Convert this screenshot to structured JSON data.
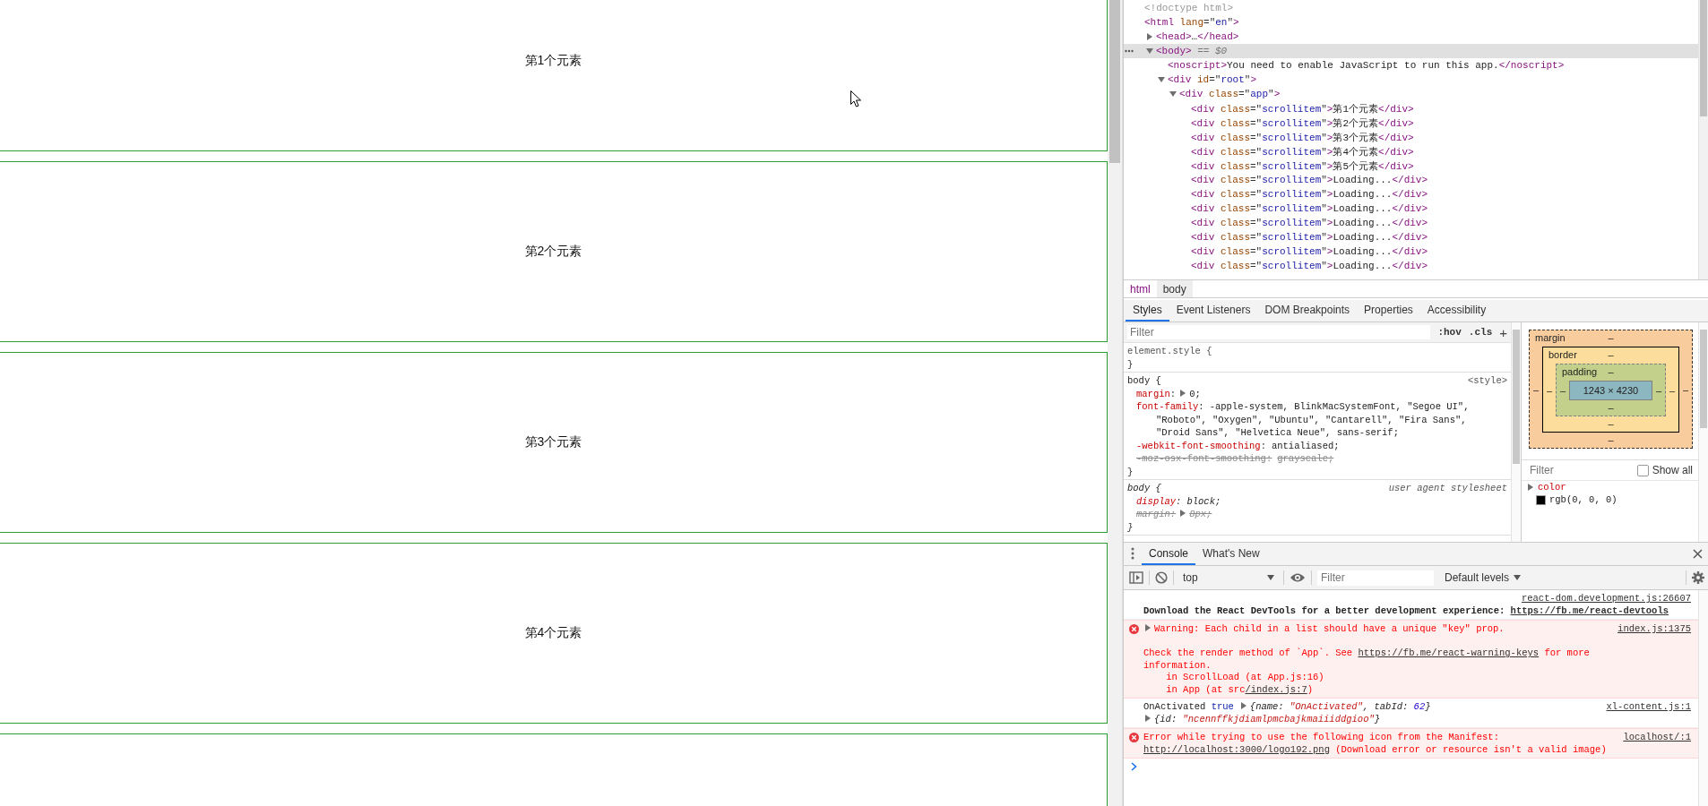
{
  "page": {
    "items": [
      {
        "kind": "card",
        "label": "第1个元素"
      },
      {
        "kind": "card",
        "label": "第2个元素"
      },
      {
        "kind": "card",
        "label": "第3个元素"
      },
      {
        "kind": "card",
        "label": "第4个元素"
      },
      {
        "kind": "card"
      }
    ]
  },
  "elements": {
    "tree": [
      {
        "selected": false,
        "tokens": [
          {
            "kind": "comment",
            "text": "<!doctype html>"
          }
        ]
      },
      {
        "selected": false,
        "tokens": [
          {
            "kind": "tag",
            "text": "<html"
          },
          {
            "kind": "attr",
            "text": " lang"
          },
          {
            "kind": "punct",
            "text": "=\""
          },
          {
            "kind": "value",
            "text": "en"
          },
          {
            "kind": "punct",
            "text": "\""
          },
          {
            "kind": "tag",
            "text": ">"
          }
        ],
        "children": [
          {
            "selected": false,
            "expanded": false,
            "tokens": [
              {
                "kind": "tag",
                "text": "<head>"
              },
              {
                "kind": "text",
                "text": "…"
              },
              {
                "kind": "tag",
                "text": "</head>"
              }
            ]
          },
          {
            "selected": true,
            "expanded": true,
            "tokens": [
              {
                "kind": "tag",
                "text": "<body>"
              },
              {
                "kind": "hint",
                "text": " == $0"
              }
            ],
            "children": [
              {
                "selected": false,
                "tokens": [
                  {
                    "kind": "tag",
                    "text": "<noscript>"
                  },
                  {
                    "kind": "text",
                    "text": "You need to enable JavaScript to run this app."
                  },
                  {
                    "kind": "tag",
                    "text": "</noscript>"
                  }
                ]
              },
              {
                "selected": false,
                "expanded": true,
                "tokens": [
                  {
                    "kind": "tag",
                    "text": "<div"
                  },
                  {
                    "kind": "attr",
                    "text": " id"
                  },
                  {
                    "kind": "punct",
                    "text": "=\""
                  },
                  {
                    "kind": "value",
                    "text": "root"
                  },
                  {
                    "kind": "punct",
                    "text": "\""
                  },
                  {
                    "kind": "tag",
                    "text": ">"
                  }
                ],
                "children": [
                  {
                    "selected": false,
                    "expanded": true,
                    "tokens": [
                      {
                        "kind": "tag",
                        "text": "<div"
                      },
                      {
                        "kind": "attr",
                        "text": " class"
                      },
                      {
                        "kind": "punct",
                        "text": "=\""
                      },
                      {
                        "kind": "value",
                        "text": "app"
                      },
                      {
                        "kind": "punct",
                        "text": "\""
                      },
                      {
                        "kind": "tag",
                        "text": ">"
                      }
                    ],
                    "children": [
                      {
                        "selected": false,
                        "tokens": [
                          {
                            "kind": "tag",
                            "text": "<div"
                          },
                          {
                            "kind": "attr",
                            "text": " class"
                          },
                          {
                            "kind": "punct",
                            "text": "=\""
                          },
                          {
                            "kind": "value",
                            "text": "scrollitem"
                          },
                          {
                            "kind": "punct",
                            "text": "\""
                          },
                          {
                            "kind": "tag",
                            "text": ">"
                          },
                          {
                            "kind": "text",
                            "text": "第1个元素"
                          },
                          {
                            "kind": "tag",
                            "text": "</div>"
                          }
                        ]
                      },
                      {
                        "selected": false,
                        "tokens": [
                          {
                            "kind": "tag",
                            "text": "<div"
                          },
                          {
                            "kind": "attr",
                            "text": " class"
                          },
                          {
                            "kind": "punct",
                            "text": "=\""
                          },
                          {
                            "kind": "value",
                            "text": "scrollitem"
                          },
                          {
                            "kind": "punct",
                            "text": "\""
                          },
                          {
                            "kind": "tag",
                            "text": ">"
                          },
                          {
                            "kind": "text",
                            "text": "第2个元素"
                          },
                          {
                            "kind": "tag",
                            "text": "</div>"
                          }
                        ]
                      },
                      {
                        "selected": false,
                        "tokens": [
                          {
                            "kind": "tag",
                            "text": "<div"
                          },
                          {
                            "kind": "attr",
                            "text": " class"
                          },
                          {
                            "kind": "punct",
                            "text": "=\""
                          },
                          {
                            "kind": "value",
                            "text": "scrollitem"
                          },
                          {
                            "kind": "punct",
                            "text": "\""
                          },
                          {
                            "kind": "tag",
                            "text": ">"
                          },
                          {
                            "kind": "text",
                            "text": "第3个元素"
                          },
                          {
                            "kind": "tag",
                            "text": "</div>"
                          }
                        ]
                      },
                      {
                        "selected": false,
                        "tokens": [
                          {
                            "kind": "tag",
                            "text": "<div"
                          },
                          {
                            "kind": "attr",
                            "text": " class"
                          },
                          {
                            "kind": "punct",
                            "text": "=\""
                          },
                          {
                            "kind": "value",
                            "text": "scrollitem"
                          },
                          {
                            "kind": "punct",
                            "text": "\""
                          },
                          {
                            "kind": "tag",
                            "text": ">"
                          },
                          {
                            "kind": "text",
                            "text": "第4个元素"
                          },
                          {
                            "kind": "tag",
                            "text": "</div>"
                          }
                        ]
                      },
                      {
                        "selected": false,
                        "tokens": [
                          {
                            "kind": "tag",
                            "text": "<div"
                          },
                          {
                            "kind": "attr",
                            "text": " class"
                          },
                          {
                            "kind": "punct",
                            "text": "=\""
                          },
                          {
                            "kind": "value",
                            "text": "scrollitem"
                          },
                          {
                            "kind": "punct",
                            "text": "\""
                          },
                          {
                            "kind": "tag",
                            "text": ">"
                          },
                          {
                            "kind": "text",
                            "text": "第5个元素"
                          },
                          {
                            "kind": "tag",
                            "text": "</div>"
                          }
                        ]
                      },
                      {
                        "selected": false,
                        "tokens": [
                          {
                            "kind": "tag",
                            "text": "<div"
                          },
                          {
                            "kind": "attr",
                            "text": " class"
                          },
                          {
                            "kind": "punct",
                            "text": "=\""
                          },
                          {
                            "kind": "value",
                            "text": "scrollitem"
                          },
                          {
                            "kind": "punct",
                            "text": "\""
                          },
                          {
                            "kind": "tag",
                            "text": ">"
                          },
                          {
                            "kind": "text",
                            "text": "Loading..."
                          },
                          {
                            "kind": "tag",
                            "text": "</div>"
                          }
                        ]
                      },
                      {
                        "selected": false,
                        "tokens": [
                          {
                            "kind": "tag",
                            "text": "<div"
                          },
                          {
                            "kind": "attr",
                            "text": " class"
                          },
                          {
                            "kind": "punct",
                            "text": "=\""
                          },
                          {
                            "kind": "value",
                            "text": "scrollitem"
                          },
                          {
                            "kind": "punct",
                            "text": "\""
                          },
                          {
                            "kind": "tag",
                            "text": ">"
                          },
                          {
                            "kind": "text",
                            "text": "Loading..."
                          },
                          {
                            "kind": "tag",
                            "text": "</div>"
                          }
                        ]
                      },
                      {
                        "selected": false,
                        "tokens": [
                          {
                            "kind": "tag",
                            "text": "<div"
                          },
                          {
                            "kind": "attr",
                            "text": " class"
                          },
                          {
                            "kind": "punct",
                            "text": "=\""
                          },
                          {
                            "kind": "value",
                            "text": "scrollitem"
                          },
                          {
                            "kind": "punct",
                            "text": "\""
                          },
                          {
                            "kind": "tag",
                            "text": ">"
                          },
                          {
                            "kind": "text",
                            "text": "Loading..."
                          },
                          {
                            "kind": "tag",
                            "text": "</div>"
                          }
                        ]
                      },
                      {
                        "selected": false,
                        "tokens": [
                          {
                            "kind": "tag",
                            "text": "<div"
                          },
                          {
                            "kind": "attr",
                            "text": " class"
                          },
                          {
                            "kind": "punct",
                            "text": "=\""
                          },
                          {
                            "kind": "value",
                            "text": "scrollitem"
                          },
                          {
                            "kind": "punct",
                            "text": "\""
                          },
                          {
                            "kind": "tag",
                            "text": ">"
                          },
                          {
                            "kind": "text",
                            "text": "Loading..."
                          },
                          {
                            "kind": "tag",
                            "text": "</div>"
                          }
                        ]
                      },
                      {
                        "selected": false,
                        "tokens": [
                          {
                            "kind": "tag",
                            "text": "<div"
                          },
                          {
                            "kind": "attr",
                            "text": " class"
                          },
                          {
                            "kind": "punct",
                            "text": "=\""
                          },
                          {
                            "kind": "value",
                            "text": "scrollitem"
                          },
                          {
                            "kind": "punct",
                            "text": "\""
                          },
                          {
                            "kind": "tag",
                            "text": ">"
                          },
                          {
                            "kind": "text",
                            "text": "Loading..."
                          },
                          {
                            "kind": "tag",
                            "text": "</div>"
                          }
                        ]
                      },
                      {
                        "selected": false,
                        "tokens": [
                          {
                            "kind": "tag",
                            "text": "<div"
                          },
                          {
                            "kind": "attr",
                            "text": " class"
                          },
                          {
                            "kind": "punct",
                            "text": "=\""
                          },
                          {
                            "kind": "value",
                            "text": "scrollitem"
                          },
                          {
                            "kind": "punct",
                            "text": "\""
                          },
                          {
                            "kind": "tag",
                            "text": ">"
                          },
                          {
                            "kind": "text",
                            "text": "Loading..."
                          },
                          {
                            "kind": "tag",
                            "text": "</div>"
                          }
                        ]
                      },
                      {
                        "selected": false,
                        "tokens": [
                          {
                            "kind": "tag",
                            "text": "<div"
                          },
                          {
                            "kind": "attr",
                            "text": " class"
                          },
                          {
                            "kind": "punct",
                            "text": "=\""
                          },
                          {
                            "kind": "value",
                            "text": "scrollitem"
                          },
                          {
                            "kind": "punct",
                            "text": "\""
                          },
                          {
                            "kind": "tag",
                            "text": ">"
                          },
                          {
                            "kind": "text",
                            "text": "Loading..."
                          },
                          {
                            "kind": "tag",
                            "text": "</div>"
                          }
                        ]
                      }
                    ]
                  }
                ]
              }
            ]
          }
        ]
      }
    ],
    "breadcrumbs": [
      {
        "label": "html",
        "selected": false
      },
      {
        "label": "body",
        "selected": true
      }
    ]
  },
  "styles_panel": {
    "tabs": [
      {
        "label": "Styles",
        "selected": true
      },
      {
        "label": "Event Listeners",
        "selected": false
      },
      {
        "label": "DOM Breakpoints",
        "selected": false
      },
      {
        "label": "Properties",
        "selected": false
      },
      {
        "label": "Accessibility",
        "selected": false
      }
    ],
    "filter": {
      "placeholder": "Filter"
    },
    "toggles": [
      ":hov",
      ".cls"
    ],
    "add": "+",
    "rules": [
      {
        "kind": "inline",
        "selector": "element.style {",
        "close": "}"
      },
      {
        "kind": "author",
        "selector": "body {",
        "source": "<style>",
        "close": "}",
        "properties": [
          {
            "name": "margin",
            "separator": ":",
            "expandable": true,
            "overridden": false,
            "value_lines": [
              "0;"
            ]
          },
          {
            "name": "font-family",
            "separator": ":",
            "overridden": false,
            "value_lines": [
              "-apple-system, BlinkMacSystemFont, \"Segoe UI\",",
              "\"Roboto\", \"Oxygen\", \"Ubuntu\", \"Cantarell\", \"Fira Sans\",",
              "\"Droid Sans\", \"Helvetica Neue\", sans-serif;"
            ]
          },
          {
            "name": "-webkit-font-smoothing",
            "separator": ":",
            "overridden": false,
            "value_lines": [
              "antialiased;"
            ]
          },
          {
            "name": "-moz-osx-font-smoothing",
            "separator": ":",
            "overridden": true,
            "value_lines": [
              "grayscale;"
            ]
          }
        ]
      },
      {
        "kind": "user-agent",
        "selector": "body {",
        "source": "user agent stylesheet",
        "close": "}",
        "properties": [
          {
            "name": "display",
            "separator": ":",
            "overridden": false,
            "value_lines": [
              "block;"
            ]
          },
          {
            "name": "margin",
            "separator": ":",
            "expandable": true,
            "overridden": true,
            "value_lines": [
              "8px;"
            ]
          }
        ]
      }
    ]
  },
  "box_model": {
    "kind": "margin",
    "label": "margin",
    "top": "–",
    "left": "–",
    "right": "–",
    "bottom": "–",
    "inner": {
      "kind": "border",
      "label": "border",
      "top": "–",
      "left": "–",
      "right": "–",
      "bottom": "–",
      "inner": {
        "kind": "padding",
        "label": "padding",
        "top": "–",
        "left": "–",
        "right": "–",
        "bottom": "–",
        "inner": {
          "kind": "content",
          "label": "1243 × 4230"
        }
      }
    }
  },
  "computed": {
    "filter": {
      "placeholder": "Filter"
    },
    "show_all": {
      "label": "Show all",
      "checked": false
    },
    "properties": [
      {
        "name": "color",
        "value": "rgb(0, 0, 0)",
        "color": "#000000",
        "expanded": false
      }
    ]
  },
  "console": {
    "tabs": [
      {
        "label": "Console",
        "selected": true
      },
      {
        "label": "What's New",
        "selected": false
      }
    ],
    "context": "top",
    "filter": {
      "placeholder": "Filter"
    },
    "levels": "Default levels",
    "messages": [
      {
        "kind": "info",
        "source": "react-dom.development.js:26607",
        "segments": [
          {
            "kind": "text",
            "text": "Download the React DevTools for a better development experience: "
          },
          {
            "kind": "link",
            "text": "https://fb.me/react-devtools"
          }
        ]
      },
      {
        "kind": "error",
        "source": "index.js:1375",
        "segments": [
          {
            "kind": "expander"
          },
          {
            "kind": "text",
            "text": "Warning: Each child in a list should have a unique \"key\" prop.\n\nCheck the render method of `App`. See "
          },
          {
            "kind": "link",
            "text": "https://fb.me/react-warning-keys"
          },
          {
            "kind": "text",
            "text": " for more information.\n    in ScrollLoad (at App.js:16)\n    in App (at src"
          },
          {
            "kind": "link",
            "text": "/index.js:7"
          },
          {
            "kind": "text",
            "text": ")"
          }
        ]
      },
      {
        "kind": "log",
        "source": "xl-content.js:1",
        "segments": [
          {
            "kind": "text",
            "text": "OnActivated "
          },
          {
            "kind": "bool",
            "text": "true"
          },
          {
            "kind": "expander"
          },
          {
            "kind": "obj",
            "text": "{name: "
          },
          {
            "kind": "str",
            "text": "\"OnActivated\""
          },
          {
            "kind": "obj",
            "text": ", tabId: "
          },
          {
            "kind": "num",
            "text": "62"
          },
          {
            "kind": "obj",
            "text": "}"
          },
          {
            "kind": "break"
          },
          {
            "kind": "expander"
          },
          {
            "kind": "obj",
            "text": "{id: "
          },
          {
            "kind": "str",
            "text": "\"ncennffkjdiamlpmcbajkmaiiiddgioo\""
          },
          {
            "kind": "obj",
            "text": "}"
          }
        ]
      },
      {
        "kind": "error",
        "source": "localhost/:1",
        "segments": [
          {
            "kind": "text",
            "text": "Error while trying to use the following icon from the Manifest: "
          },
          {
            "kind": "link",
            "text": "http://localhost:3000/logo192.png"
          },
          {
            "kind": "text",
            "text": " (Download error or resource isn't a valid image)"
          }
        ]
      },
      {
        "kind": "prompt"
      }
    ]
  }
}
